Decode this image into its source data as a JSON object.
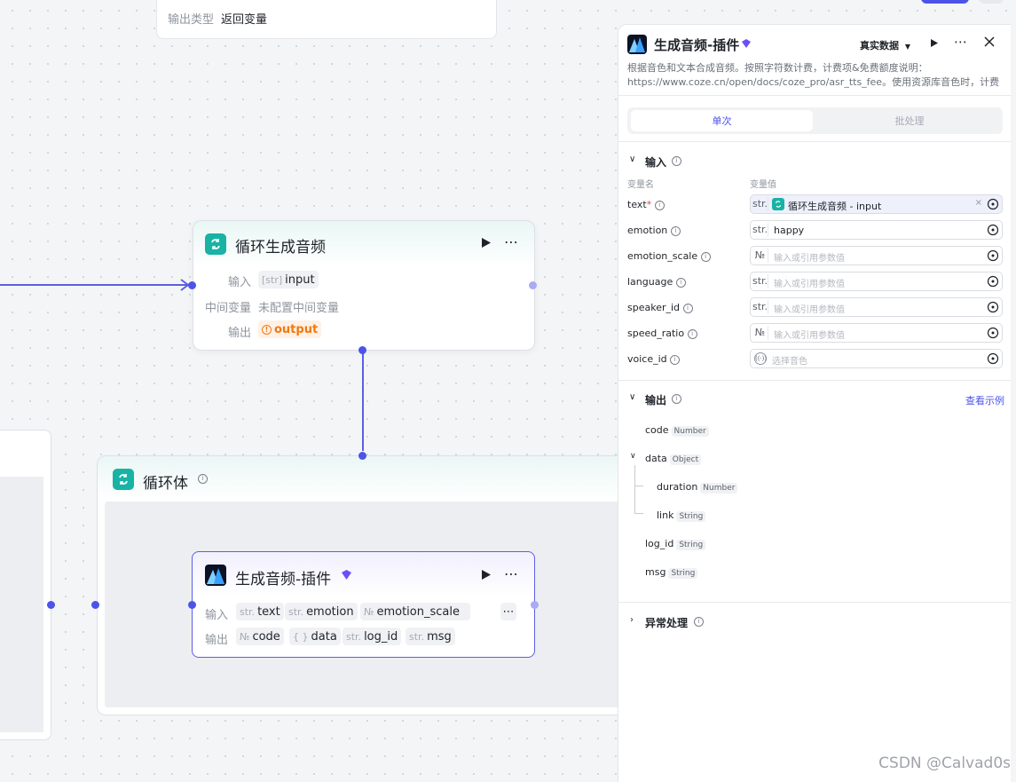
{
  "canvas": {
    "top_node": {
      "label": "输出类型",
      "value": "返回变量"
    },
    "loop_node": {
      "title": "循环生成音频",
      "input_label": "输入",
      "input_value": "input",
      "input_type": "[str]",
      "mid_label": "中间变量",
      "mid_value": "未配置中间变量",
      "output_label": "输出",
      "output_value": "output"
    },
    "loop_body": {
      "title": "循环体"
    },
    "plugin_node": {
      "title": "生成音频-插件",
      "input_label": "输入",
      "inputs": [
        {
          "type": "str.",
          "name": "text"
        },
        {
          "type": "str.",
          "name": "emotion"
        },
        {
          "type": "№",
          "name": "emotion_scale"
        }
      ],
      "output_label": "输出",
      "outputs": [
        {
          "type": "№",
          "name": "code"
        },
        {
          "type": "{ }",
          "name": "data"
        },
        {
          "type": "str.",
          "name": "log_id"
        },
        {
          "type": "str.",
          "name": "msg"
        }
      ]
    }
  },
  "panel": {
    "title": "生成音频-插件",
    "data_mode": "真实数据",
    "description": "根据音色和文本合成音频。按照字符数计费，计费项&免费额度说明：https://www.coze.cn/open/docs/coze_pro/asr_tts_fee。使用资源库音色时，计费项为复刻音色文字…",
    "tabs": {
      "single": "单次",
      "batch": "批处理"
    },
    "input_section": {
      "title": "输入",
      "col_name": "变量名",
      "col_value": "变量值",
      "vars": [
        {
          "name": "text",
          "required": "*",
          "type": "str.",
          "value": "循环生成音频 - input",
          "placeholder": ""
        },
        {
          "name": "emotion",
          "required": "",
          "type": "str.",
          "value": "happy",
          "placeholder": ""
        },
        {
          "name": "emotion_scale",
          "required": "",
          "type": "№",
          "value": "",
          "placeholder": "输入或引用参数值"
        },
        {
          "name": "language",
          "required": "",
          "type": "str.",
          "value": "",
          "placeholder": "输入或引用参数值"
        },
        {
          "name": "speaker_id",
          "required": "",
          "type": "str.",
          "value": "",
          "placeholder": "输入或引用参数值"
        },
        {
          "name": "speed_ratio",
          "required": "",
          "type": "№",
          "value": "",
          "placeholder": "输入或引用参数值"
        },
        {
          "name": "voice_id",
          "required": "",
          "type": "voice",
          "value": "",
          "placeholder": "选择音色"
        }
      ]
    },
    "output_section": {
      "title": "输出",
      "link": "查看示例",
      "fields": [
        {
          "name": "code",
          "type": "Number"
        },
        {
          "name": "data",
          "type": "Object"
        },
        {
          "name": "duration",
          "type": "Number"
        },
        {
          "name": "link",
          "type": "String"
        },
        {
          "name": "log_id",
          "type": "String"
        },
        {
          "name": "msg",
          "type": "String"
        }
      ]
    },
    "error_section": {
      "title": "异常处理"
    }
  },
  "watermark": "CSDN @Calvad0s",
  "colors": {
    "accent": "#4d53e8",
    "loop_icon": "#18b3a4",
    "warn": "#f2790c"
  }
}
